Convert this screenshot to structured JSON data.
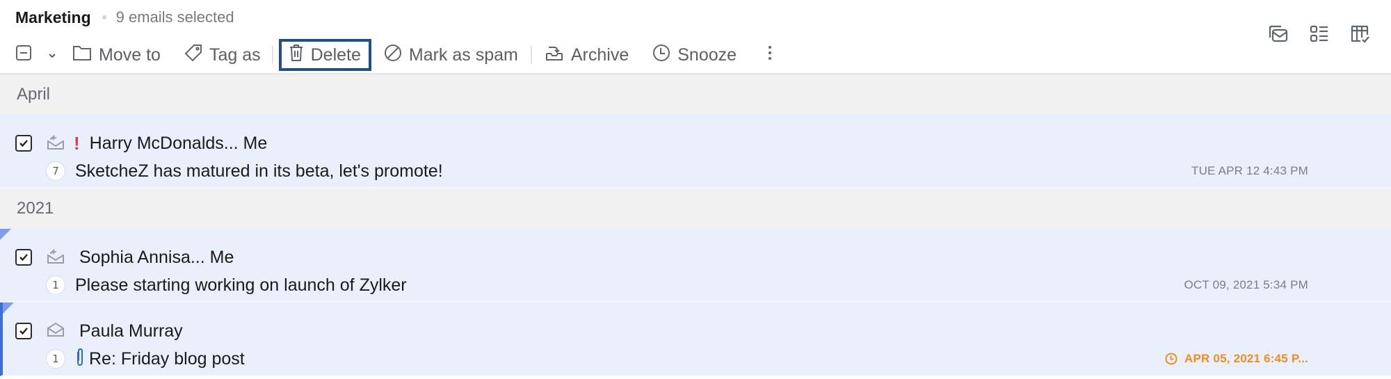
{
  "header": {
    "folder_title": "Marketing",
    "selected_count": "9 emails selected"
  },
  "toolbar": {
    "select_icon": "select-partial-icon",
    "dropdown_icon": "chevron-down-icon",
    "move_to": "Move to",
    "tag_as": "Tag as",
    "delete": "Delete",
    "mark_as_spam": "Mark as spam",
    "archive": "Archive",
    "snooze": "Snooze",
    "more_icon": "more-vertical-icon",
    "highlight_color": "#1d4f8c"
  },
  "view_icons": [
    "conversation-view-icon",
    "list-view-icon",
    "table-check-view-icon"
  ],
  "groups": [
    {
      "label": "April",
      "emails": [
        {
          "checked": true,
          "status_icon": "replied-mail-icon",
          "priority": "!",
          "sender": "Harry McDonalds... Me",
          "thread_count": "7",
          "has_attachment": false,
          "subject": "SketcheZ has matured in its beta, let's promote!",
          "date": "TUE APR 12 4:43 PM",
          "reminder": false
        }
      ]
    },
    {
      "label": "2021",
      "emails": [
        {
          "checked": true,
          "status_icon": "replied-mail-icon",
          "priority": "",
          "sender": "Sophia Annisa... Me",
          "thread_count": "1",
          "has_attachment": false,
          "subject": "Please starting working on launch of Zylker",
          "date": "OCT 09, 2021 5:34 PM",
          "reminder": false,
          "unread_flag": true
        },
        {
          "checked": true,
          "status_icon": "opened-mail-icon",
          "priority": "",
          "sender": "Paula Murray",
          "thread_count": "1",
          "has_attachment": true,
          "subject": "Re: Friday blog post",
          "date": "APR 05, 2021 6:45 P...",
          "reminder": true,
          "reminder_color": "#f08d1e",
          "unread_flag": true,
          "focused": true
        }
      ]
    }
  ]
}
